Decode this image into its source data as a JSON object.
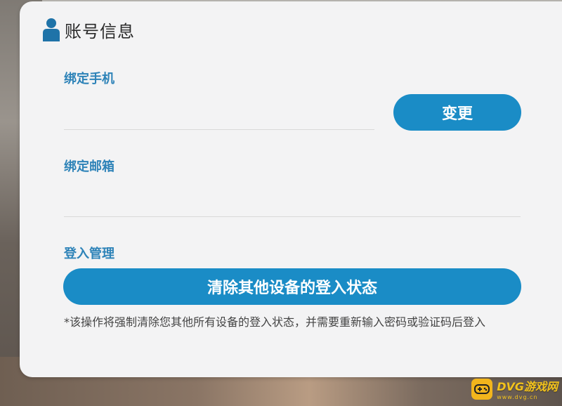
{
  "header": {
    "title": "账号信息",
    "icon": "user-icon"
  },
  "phone": {
    "label": "绑定手机",
    "value": "",
    "change_label": "变更"
  },
  "email": {
    "label": "绑定邮箱",
    "value": ""
  },
  "login": {
    "label": "登入管理",
    "clear_label": "清除其他设备的登入状态",
    "note": "*该操作将强制清除您其他所有设备的登入状态，并需要重新输入密码或验证码后登入"
  },
  "watermark": {
    "main": "DVG游戏网",
    "sub": "www.dvg.cn"
  },
  "colors": {
    "accent": "#1a8cc6",
    "label": "#2e83b8",
    "watermark": "#f2b51c"
  }
}
